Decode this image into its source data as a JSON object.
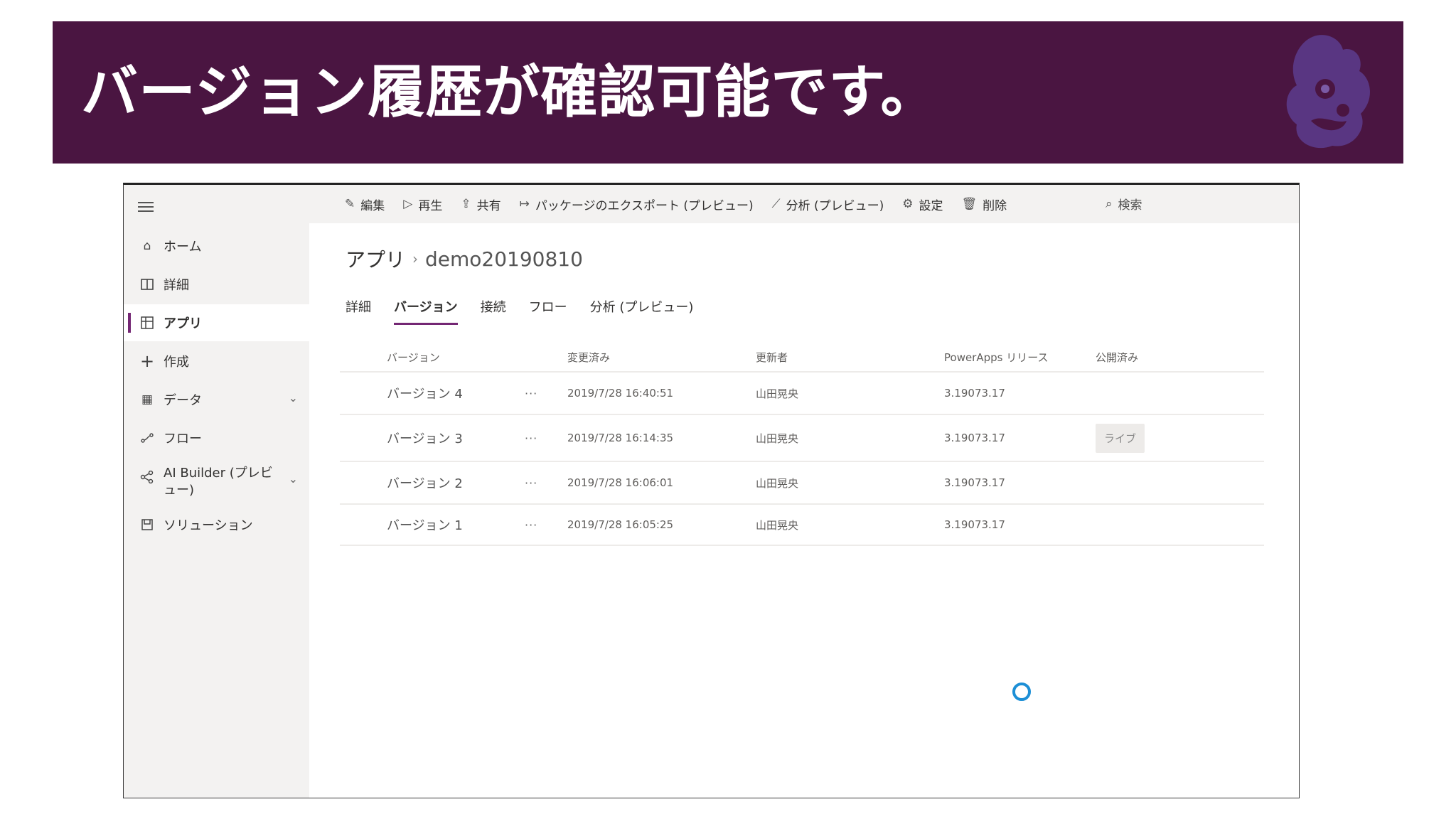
{
  "banner": {
    "title": "バージョン履歴が確認可能です。",
    "bg_color": "#4a1541",
    "logo": "dragon-logo"
  },
  "sidebar": {
    "items": [
      {
        "label": "ホーム",
        "icon": "home-icon"
      },
      {
        "label": "詳細",
        "icon": "book-icon"
      },
      {
        "label": "アプリ",
        "icon": "apps-icon",
        "active": true
      },
      {
        "label": "作成",
        "icon": "plus-icon"
      },
      {
        "label": "データ",
        "icon": "table-icon",
        "expandable": true
      },
      {
        "label": "フロー",
        "icon": "flow-icon"
      },
      {
        "label": "AI Builder (プレビュー)",
        "icon": "ai-builder-icon",
        "expandable": true
      },
      {
        "label": "ソリューション",
        "icon": "solution-icon"
      }
    ]
  },
  "commandbar": {
    "items": [
      {
        "label": "編集",
        "icon": "pencil-icon"
      },
      {
        "label": "再生",
        "icon": "play-icon"
      },
      {
        "label": "共有",
        "icon": "share-icon"
      },
      {
        "label": "パッケージのエクスポート (プレビュー)",
        "icon": "export-icon"
      },
      {
        "label": "分析 (プレビュー)",
        "icon": "chart-icon"
      },
      {
        "label": "設定",
        "icon": "gear-icon"
      },
      {
        "label": "削除",
        "icon": "trash-icon"
      }
    ],
    "search_label": "検索"
  },
  "breadcrumb": {
    "root": "アプリ",
    "current": "demo20190810"
  },
  "tabs": [
    {
      "label": "詳細"
    },
    {
      "label": "バージョン",
      "active": true
    },
    {
      "label": "接続"
    },
    {
      "label": "フロー"
    },
    {
      "label": "分析 (プレビュー)"
    }
  ],
  "table": {
    "headers": [
      "バージョン",
      "変更済み",
      "更新者",
      "PowerApps リリース",
      "公開済み"
    ],
    "rows": [
      {
        "name": "バージョン 4",
        "dots": "···",
        "modified": "2019/7/28 16:40:51",
        "by": "山田晃央",
        "release": "3.19073.17",
        "published": ""
      },
      {
        "name": "バージョン 3",
        "dots": "···",
        "modified": "2019/7/28 16:14:35",
        "by": "山田晃央",
        "release": "3.19073.17",
        "published": "ライブ"
      },
      {
        "name": "バージョン 2",
        "dots": "···",
        "modified": "2019/7/28 16:06:01",
        "by": "山田晃央",
        "release": "3.19073.17",
        "published": ""
      },
      {
        "name": "バージョン 1",
        "dots": "···",
        "modified": "2019/7/28 16:05:25",
        "by": "山田晃央",
        "release": "3.19073.17",
        "published": ""
      }
    ]
  },
  "colors": {
    "accent": "#742774",
    "spinner": "#1d8fd6"
  }
}
